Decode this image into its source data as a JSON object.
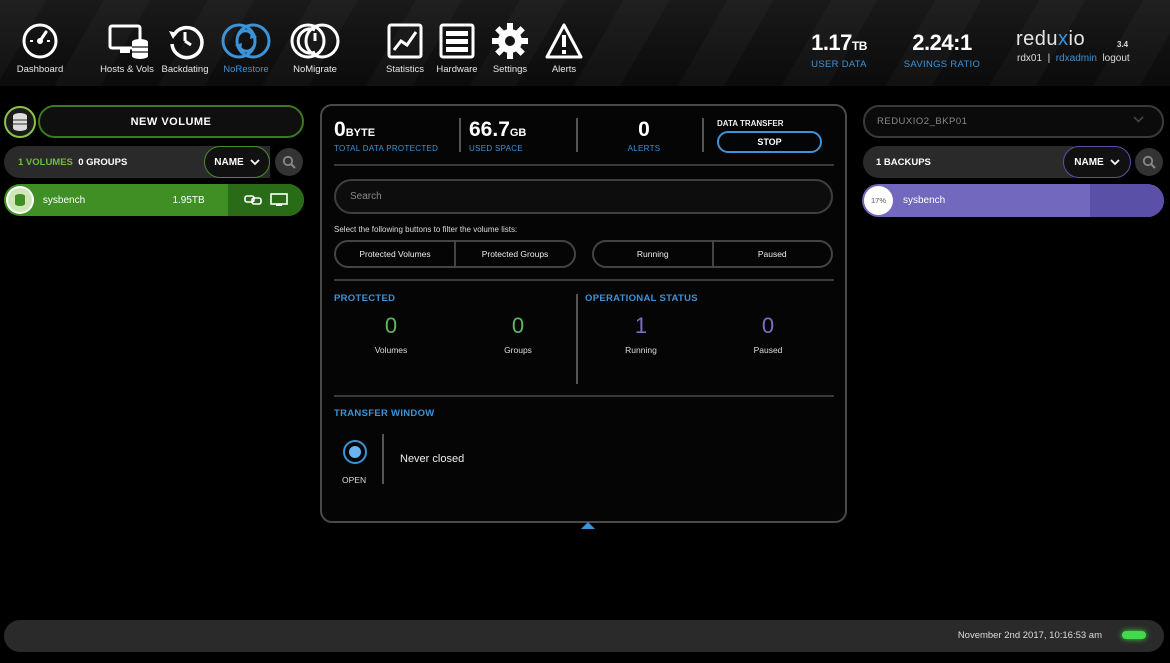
{
  "nav": {
    "dashboard": "Dashboard",
    "hosts_vols": "Hosts & Vols",
    "backdating": "Backdating",
    "norestore": "NoRestore",
    "nomigrate": "NoMigrate",
    "statistics": "Statistics",
    "hardware": "Hardware",
    "settings": "Settings",
    "alerts": "Alerts",
    "active": "NoRestore"
  },
  "header_stats": {
    "user_data_value": "1.17",
    "user_data_unit": "TB",
    "user_data_label": "USER DATA",
    "savings_value": "2.24:1",
    "savings_label": "SAVINGS RATIO"
  },
  "brand": {
    "name_a": "redu",
    "name_x": "x",
    "name_b": "io",
    "version": "3.4",
    "system": "rdx01",
    "separator": "|",
    "user": "rdxadmin",
    "logout": "logout"
  },
  "left": {
    "new_volume": "NEW VOLUME",
    "volumes_count": "1 VOLUMES",
    "groups_count": "0 GROUPS",
    "sort_label": "NAME",
    "volumes": [
      {
        "name": "sysbench",
        "size": "1.95TB"
      }
    ]
  },
  "center": {
    "total_protected_value": "0",
    "total_protected_unit": "BYTE",
    "total_protected_label": "TOTAL DATA PROTECTED",
    "used_space_value": "66.7",
    "used_space_unit": "GB",
    "used_space_label": "USED SPACE",
    "alerts_value": "0",
    "alerts_label": "ALERTS",
    "data_transfer_label": "DATA TRANSFER",
    "stop_label": "STOP",
    "search_placeholder": "Search",
    "filter_note": "Select the following buttons to filter the volume lists:",
    "filters_a": [
      "Protected Volumes",
      "Protected Groups"
    ],
    "filters_b": [
      "Running",
      "Paused"
    ],
    "protected_title": "PROTECTED",
    "operational_title": "OPERATIONAL STATUS",
    "protected_volumes": "0",
    "protected_volumes_label": "Volumes",
    "protected_groups": "0",
    "protected_groups_label": "Groups",
    "running": "1",
    "running_label": "Running",
    "paused": "0",
    "paused_label": "Paused",
    "transfer_window_title": "TRANSFER WINDOW",
    "transfer_state": "OPEN",
    "transfer_text": "Never closed"
  },
  "right": {
    "target": "REDUXIO2_BKP01",
    "backups_count": "1 BACKUPS",
    "sort_label": "NAME",
    "backups": [
      {
        "name": "sysbench",
        "progress": "17%"
      }
    ]
  },
  "footer": {
    "timestamp": "November 2nd 2017, 10:16:53 am"
  },
  "colors": {
    "accent_blue": "#3c93d8",
    "volume_green": "#3f8f25",
    "backup_purple": "#7268bd",
    "status_led": "#44d94a"
  }
}
